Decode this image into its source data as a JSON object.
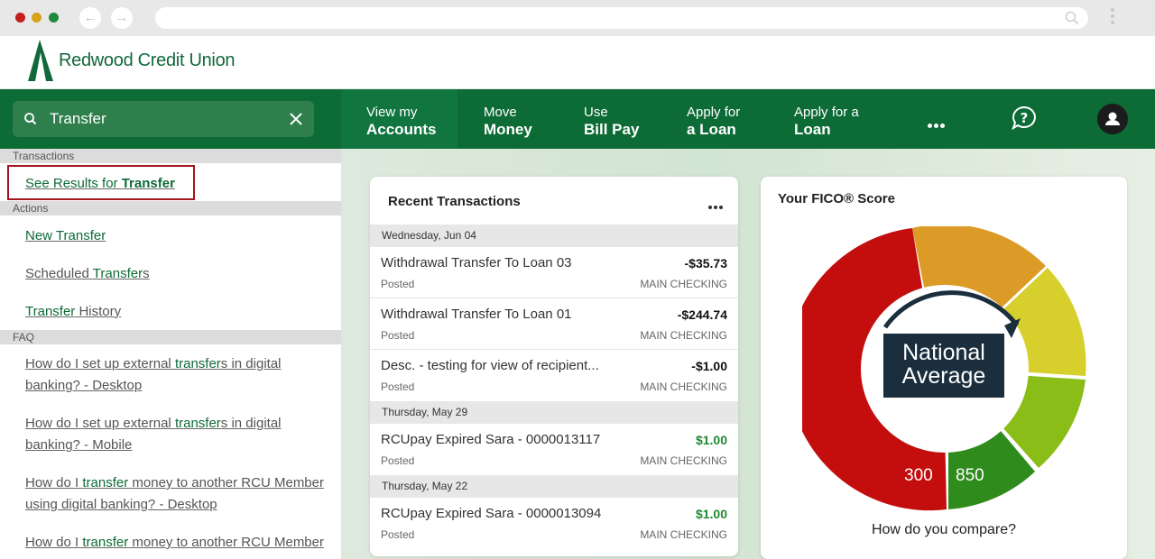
{
  "browser": {
    "back_icon": "←",
    "forward_icon": "→"
  },
  "logo": {
    "text": "Redwood Credit Union"
  },
  "search": {
    "value": "Transfer"
  },
  "nav": [
    {
      "line1": "View my",
      "line2": "Accounts",
      "active": true
    },
    {
      "line1": "Move",
      "line2": "Money"
    },
    {
      "line1": "Use",
      "line2": "Bill Pay"
    },
    {
      "line1": "Apply for",
      "line2": "a Loan"
    },
    {
      "line1": "Apply for a",
      "line2": "Loan"
    }
  ],
  "dropdown": {
    "sections": {
      "transactions": "Transactions",
      "actions": "Actions",
      "faq": "FAQ"
    },
    "see_results": {
      "pre": "See Results for ",
      "term": "Transfer"
    },
    "actions": [
      {
        "hl": "New Transfer",
        "rest": ""
      },
      {
        "pre": "Scheduled ",
        "hl": "Transfer",
        "rest": "s"
      },
      {
        "hl": "Transfer",
        "rest": " History"
      }
    ],
    "faq": [
      {
        "pre": "How do I set up external ",
        "hl": "transfer",
        "rest": "s in digital banking? - Desktop"
      },
      {
        "pre": "How do I set up external ",
        "hl": "transfer",
        "rest": "s in digital banking? - Mobile"
      },
      {
        "pre": "How do I ",
        "hl": "transfer",
        "rest": " money to another RCU Member using digital banking? - Desktop"
      },
      {
        "pre": "How do I ",
        "hl": "transfer",
        "rest": " money to another RCU Member"
      }
    ]
  },
  "transactions": {
    "title": "Recent Transactions",
    "groups": [
      {
        "date": "Wednesday, Jun 04",
        "items": [
          {
            "desc": "Withdrawal Transfer To Loan 03",
            "amount": "-$35.73",
            "status": "Posted",
            "account": "MAIN CHECKING"
          },
          {
            "desc": "Withdrawal Transfer To Loan 01",
            "amount": "-$244.74",
            "status": "Posted",
            "account": "MAIN CHECKING"
          },
          {
            "desc": "Desc. - testing for view of recipient...",
            "amount": "-$1.00",
            "status": "Posted",
            "account": "MAIN CHECKING"
          }
        ]
      },
      {
        "date": "Thursday, May 29",
        "items": [
          {
            "desc": "RCUpay Expired Sara - 0000013117",
            "amount": "$1.00",
            "status": "Posted",
            "account": "MAIN CHECKING"
          }
        ]
      },
      {
        "date": "Thursday, May 22",
        "items": [
          {
            "desc": "RCUpay Expired Sara - 0000013094",
            "amount": "$1.00",
            "status": "Posted",
            "account": "MAIN CHECKING"
          }
        ]
      }
    ]
  },
  "fico": {
    "title": "Your FICO® Score",
    "badge_line1": "National",
    "badge_line2": "Average",
    "min": "300",
    "max": "850",
    "compare": "How do you compare?",
    "colors": {
      "red": "#c40d0d",
      "orange": "#dc9b27",
      "yellow": "#d7cf2c",
      "lime": "#8bbd18",
      "green": "#2e8b1c"
    }
  },
  "colors": {
    "brand_green": "#0d6b36",
    "highlight_red": "#a2151c"
  }
}
